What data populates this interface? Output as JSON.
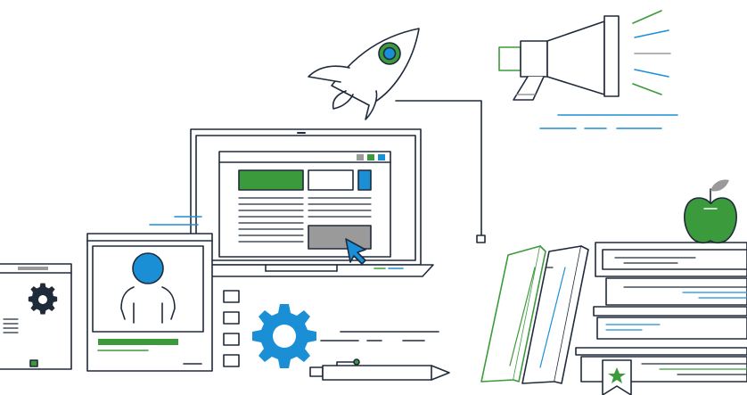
{
  "colors": {
    "outline": "#1f2a3a",
    "blue": "#1a8fd6",
    "green": "#3b9a3b",
    "gray": "#9a9a9a",
    "background": "#ffffff"
  },
  "illustration": {
    "elements": [
      "rocket-icon",
      "megaphone-icon",
      "laptop-icon",
      "web-page-mockup",
      "cursor-icon",
      "profile-document-icon",
      "settings-panel-icon",
      "gear-icon",
      "checklist-icon",
      "pen-icon",
      "book-stack-icon",
      "leaning-books-icon",
      "apple-icon",
      "star-bookmark-icon"
    ]
  }
}
